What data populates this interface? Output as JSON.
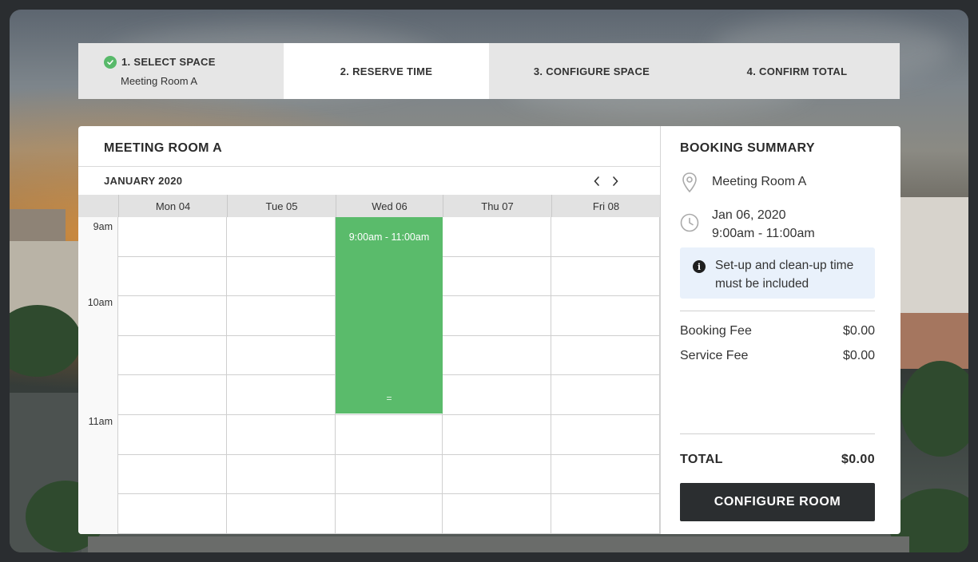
{
  "steps": [
    {
      "label": "1. SELECT SPACE",
      "sub": "Meeting Room A",
      "status": "done"
    },
    {
      "label": "2. RESERVE TIME",
      "status": "active"
    },
    {
      "label": "3. CONFIGURE SPACE",
      "status": "pending"
    },
    {
      "label": "4. CONFIRM TOTAL",
      "status": "pending"
    }
  ],
  "calendar": {
    "room_title": "MEETING ROOM A",
    "month": "JANUARY 2020",
    "days": [
      "Mon 04",
      "Tue 05",
      "Wed 06",
      "Thu 07",
      "Fri 08"
    ],
    "times": [
      "9am",
      "10am",
      "11am"
    ],
    "event": {
      "label": "9:00am - 11:00am",
      "day": "Wed 06",
      "start": "9:00am",
      "end": "11:00am",
      "handle": "="
    }
  },
  "summary": {
    "title": "BOOKING SUMMARY",
    "location": "Meeting Room A",
    "date": "Jan 06, 2020",
    "time": "9:00am - 11:00am",
    "info": "Set-up and clean-up time must be included",
    "fees": [
      {
        "label": "Booking Fee",
        "value": "$0.00"
      },
      {
        "label": "Service Fee",
        "value": "$0.00"
      }
    ],
    "total_label": "TOTAL",
    "total_value": "$0.00",
    "button": "CONFIGURE ROOM"
  },
  "colors": {
    "accent_green": "#5abb6b",
    "button_dark": "#2b2e30",
    "info_bg": "#e9f1fb"
  },
  "icons": [
    "check-icon",
    "chevron-left-icon",
    "chevron-right-icon",
    "map-pin-icon",
    "clock-icon",
    "info-icon"
  ]
}
